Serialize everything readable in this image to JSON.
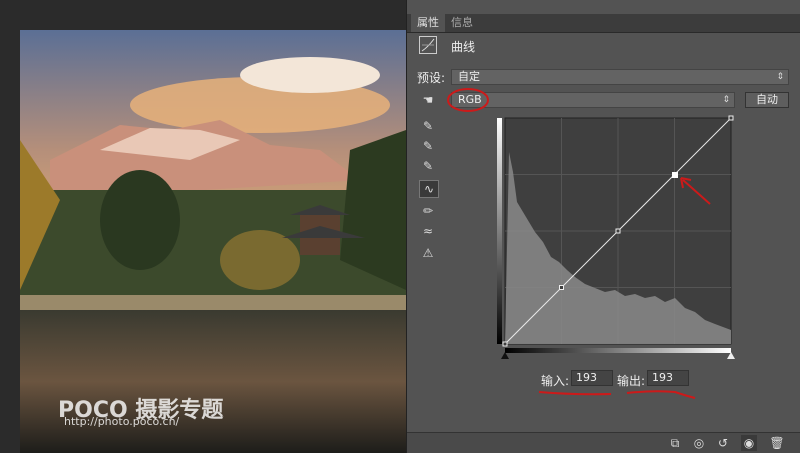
{
  "tabs": [
    {
      "label": "属性"
    },
    {
      "label": "信息"
    }
  ],
  "panel": {
    "title": "曲线",
    "preset_label": "预设:",
    "preset_value": "自定",
    "channel_value": "RGB",
    "auto_button": "自动",
    "input_label": "输入:",
    "input_value": "193",
    "output_label": "输出:",
    "output_value": "193"
  },
  "watermark": {
    "brand": "POCO 摄影专题",
    "url": "http://photo.poco.cn/"
  },
  "icons": [
    "curves-adjust-icon",
    "hand-target-icon",
    "eyedropper-black-icon",
    "eyedropper-gray-icon",
    "eyedropper-white-icon",
    "curve-tool-icon",
    "pencil-tool-icon",
    "smooth-icon",
    "clipping-warning-icon",
    "clip-to-layer-icon",
    "view-previous-icon",
    "reset-icon",
    "visibility-eye-icon",
    "trash-icon"
  ],
  "accent": {
    "annotation_red": "#cc1a1a"
  }
}
